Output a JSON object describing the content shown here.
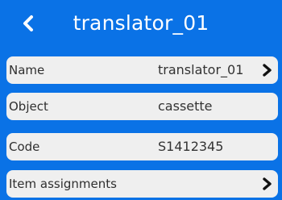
{
  "header": {
    "title": "translator_01",
    "back_icon": "chevron-left-icon"
  },
  "rows": [
    {
      "label": "Name",
      "value": "translator_01",
      "has_arrow": true
    },
    {
      "label": "Object",
      "value": "cassette",
      "has_arrow": false
    },
    {
      "label": "Code",
      "value": "S1412345",
      "has_arrow": false
    },
    {
      "label": "Item assignments",
      "value": "",
      "has_arrow": true
    }
  ],
  "colors": {
    "background": "#0a72e6",
    "row_background": "#efefef",
    "title_text": "#ffffff"
  }
}
